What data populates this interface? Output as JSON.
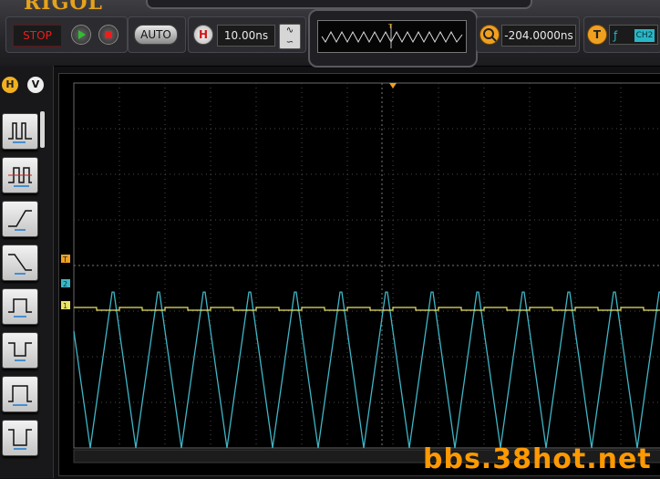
{
  "brand": "RIGOL",
  "run_control": {
    "stop_label": "STOP",
    "auto_label": "AUTO"
  },
  "horizontal": {
    "badge": "H",
    "timebase": "10.00ns"
  },
  "zoom": {
    "offset": "-204.0000ns"
  },
  "trigger": {
    "badge": "T",
    "slope": "ƒ",
    "source": "CH2",
    "marker": "T"
  },
  "side_tabs": {
    "horizontal": "H",
    "vertical": "V"
  },
  "channel_markers": {
    "ch1": "1",
    "ch2": "2",
    "trigger": "T"
  },
  "trigger_modes": [
    "pulse-positive",
    "pulse-runt",
    "rising-slope",
    "falling-slope",
    "pulse-window",
    "pattern",
    "timeout",
    "setup-hold"
  ],
  "traces": {
    "ch1": {
      "color": "#e8e468",
      "shape": "flat with small pulses"
    },
    "ch2": {
      "color": "#3fb6c6",
      "shape": "triangle wave"
    }
  },
  "watermark": "bbs.38hot.net",
  "colors": {
    "accent": "#e6a21c",
    "stop": "#ee1c1c",
    "run": "#2fbf2f",
    "grid": "#4a4a4a"
  }
}
